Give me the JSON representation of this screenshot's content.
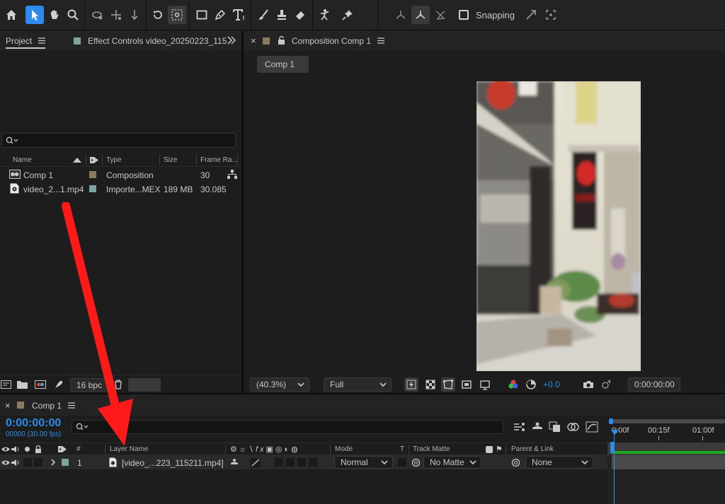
{
  "toolbar": {
    "snapping_label": "Snapping"
  },
  "project_panel": {
    "tab_project": "Project",
    "tab_effect_controls": "Effect Controls video_20250223_115",
    "columns": {
      "name": "Name",
      "type": "Type",
      "size": "Size",
      "frame_rate": "Frame Ra..."
    },
    "rows": [
      {
        "name": "Comp 1",
        "type": "Composition",
        "size": "",
        "frame_rate": "30",
        "color": "#8a7a5e"
      },
      {
        "name": "video_2...1.mp4",
        "type": "Importe...MEX",
        "size": "189 MB",
        "frame_rate": "30.085",
        "color": "#7fa3a0"
      }
    ],
    "bpc_label": "16 bpc"
  },
  "composition_panel": {
    "tab_label": "Composition Comp 1",
    "comp_button": "Comp 1",
    "zoom": "(40.3%)",
    "resolution": "Full",
    "exposure": "+0.0",
    "timecode": "0:00:00:00"
  },
  "timeline": {
    "tab_label": "Comp 1",
    "timecode": "0:00:00:00",
    "frames_fps": "00000 (30.00 fps)",
    "ruler": [
      "0:00f",
      "00:15f",
      "01:00f"
    ],
    "columns": {
      "num": "#",
      "layer_name": "Layer Name",
      "mode": "Mode",
      "t": "T",
      "track_matte": "Track Matte",
      "parent_link": "Parent & Link"
    },
    "layer": {
      "num": "1",
      "name": "[video_...223_115211.mp4]",
      "mode": "Normal",
      "matte": "No Matte",
      "parent": "None",
      "color": "#7fa3a0"
    }
  },
  "colors": {
    "accent": "#2d8ceb",
    "arrow": "#ff1a1a",
    "timeline_bar": "#1ea51e",
    "comp_label": "#8a7a5e"
  }
}
